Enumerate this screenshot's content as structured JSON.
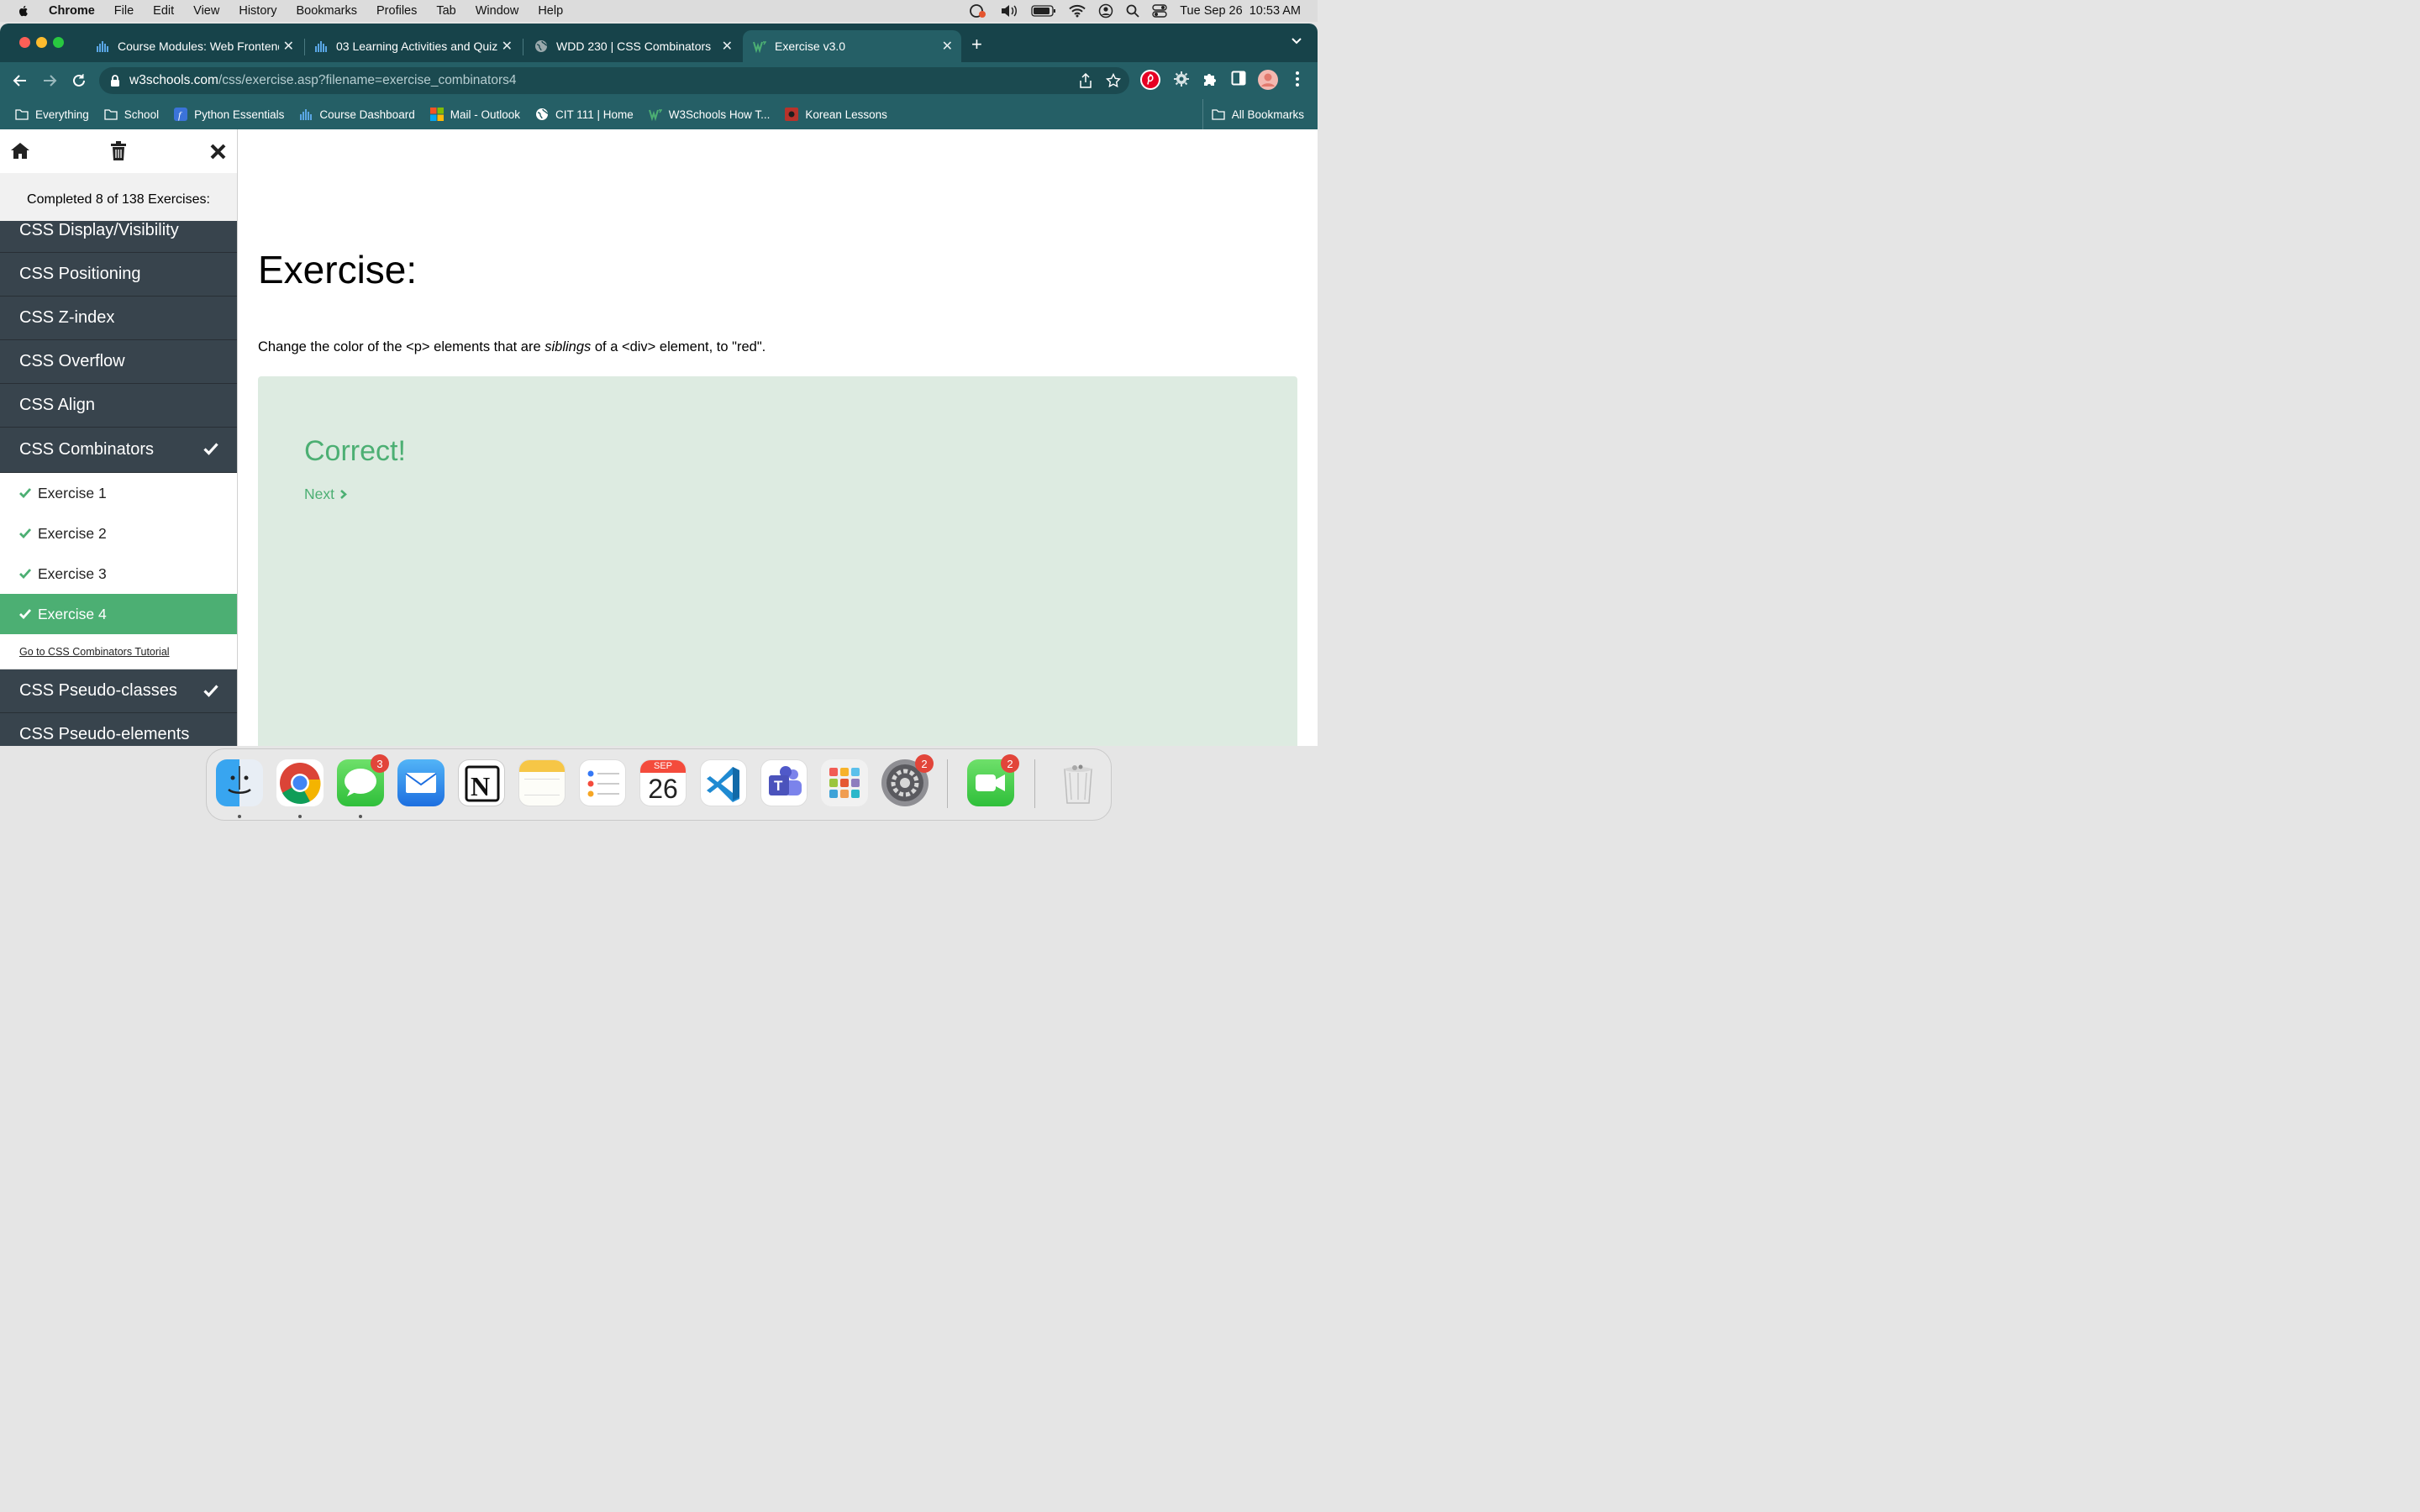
{
  "menubar": {
    "app": "Chrome",
    "items": [
      "File",
      "Edit",
      "View",
      "History",
      "Bookmarks",
      "Profiles",
      "Tab",
      "Window",
      "Help"
    ],
    "datetime": "Tue Sep 26  10:53 AM"
  },
  "tabs": [
    {
      "title": "Course Modules: Web Frontend",
      "active": false
    },
    {
      "title": "03 Learning Activities and Quiz",
      "active": false
    },
    {
      "title": "WDD 230 | CSS Combinators",
      "active": false
    },
    {
      "title": "Exercise v3.0",
      "active": true
    }
  ],
  "address": {
    "host": "w3schools.com",
    "path": "/css/exercise.asp?filename=exercise_combinators4"
  },
  "bookmarks": [
    {
      "label": "Everything",
      "icon": "folder-icon"
    },
    {
      "label": "School",
      "icon": "folder-icon"
    },
    {
      "label": "Python Essentials",
      "icon": "function-icon"
    },
    {
      "label": "Course Dashboard",
      "icon": "canvas-icon"
    },
    {
      "label": "Mail - Outlook",
      "icon": "microsoft-icon"
    },
    {
      "label": "CIT 111 | Home",
      "icon": "globe-icon"
    },
    {
      "label": "W3Schools How T...",
      "icon": "w3schools-icon"
    },
    {
      "label": "Korean Lessons",
      "icon": "korean-icon"
    }
  ],
  "all_bookmarks": "All Bookmarks",
  "sidebar": {
    "completed_text": "Completed 8 of 138 Exercises:",
    "categories_before": [
      {
        "label": "CSS Display/Visibility",
        "done": false
      },
      {
        "label": "CSS Positioning",
        "done": false
      },
      {
        "label": "CSS Z-index",
        "done": false
      },
      {
        "label": "CSS Overflow",
        "done": false
      },
      {
        "label": "CSS Align",
        "done": false
      },
      {
        "label": "CSS Combinators",
        "done": true
      }
    ],
    "exercises": [
      {
        "label": "Exercise 1",
        "active": false
      },
      {
        "label": "Exercise 2",
        "active": false
      },
      {
        "label": "Exercise 3",
        "active": false
      },
      {
        "label": "Exercise 4",
        "active": true
      }
    ],
    "tutorial_link": "Go to CSS Combinators Tutorial",
    "categories_after": [
      {
        "label": "CSS Pseudo-classes",
        "done": true
      },
      {
        "label": "CSS Pseudo-elements",
        "done": false
      }
    ]
  },
  "exercise": {
    "title": "Exercise:",
    "desc_before": "Change the color of the <p> elements that are ",
    "desc_em": "siblings",
    "desc_after": " of a <div> element, to \"red\".",
    "result_title": "Correct!",
    "next_label": "Next"
  },
  "dock": {
    "apps": [
      "Finder",
      "Chrome",
      "Messages",
      "Mail",
      "Notion",
      "Notes",
      "Reminders",
      "Calendar",
      "VS Code",
      "Teams",
      "Launchpad",
      "System Settings",
      "FaceTime",
      "Trash"
    ],
    "messages_badge": "3",
    "settings_badge": "2",
    "facetime_badge": "2",
    "calendar_month": "SEP",
    "calendar_day": "26"
  },
  "colors": {
    "tabbar": "#17434a",
    "toolbar": "#255f66",
    "sidebar_category": "#38444d",
    "accent_green": "#4caf73",
    "result_bg": "#ddebe1"
  }
}
